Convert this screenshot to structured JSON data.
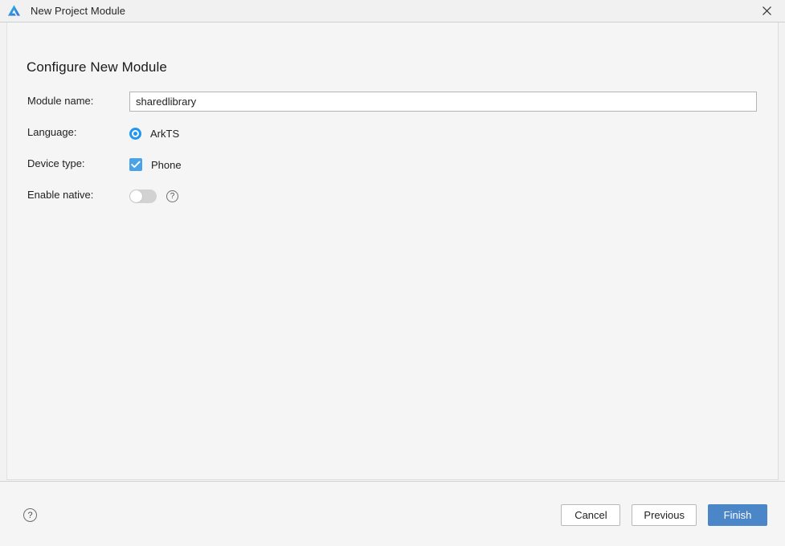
{
  "window": {
    "title": "New Project Module",
    "icon": "app-logo-icon",
    "close_label": "×"
  },
  "content": {
    "section_title": "Configure New Module",
    "fields": [
      {
        "id": "module-name",
        "label": "Module name:",
        "type": "text",
        "value": "sharedlibrary",
        "placeholder": ""
      },
      {
        "id": "language",
        "label": "Language:",
        "type": "radio",
        "options": [
          {
            "label": "ArkTS",
            "selected": true
          }
        ]
      },
      {
        "id": "device-type",
        "label": "Device type:",
        "type": "checkbox",
        "options": [
          {
            "label": "Phone",
            "checked": true
          }
        ]
      },
      {
        "id": "enable-native",
        "label": "Enable native:",
        "type": "toggle",
        "checked": false,
        "help_label": "?"
      }
    ]
  },
  "footer": {
    "help_label": "?",
    "buttons": [
      {
        "id": "cancel",
        "label": "Cancel",
        "style": "secondary"
      },
      {
        "id": "previous",
        "label": "Previous",
        "style": "secondary"
      },
      {
        "id": "finish",
        "label": "Finish",
        "style": "primary"
      }
    ]
  },
  "colors": {
    "accent_blue": "#2196f3",
    "primary_button": "#4a86c8",
    "checkbox_blue": "#4aa3e8",
    "dialog_bg": "#f2f2f2",
    "content_bg": "#f5f5f5"
  }
}
